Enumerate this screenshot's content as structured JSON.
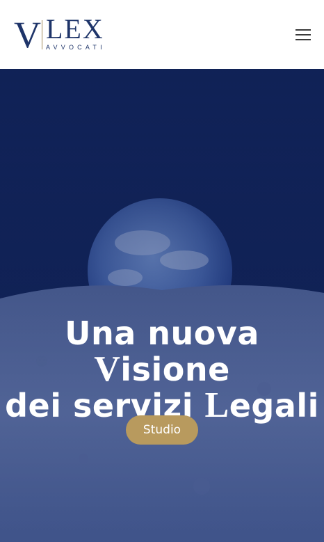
{
  "header": {
    "logo": {
      "mark": "V",
      "name": "LEX",
      "tagline": "AVVOCATI"
    },
    "menu_icon": "hamburger-menu-icon"
  },
  "hero": {
    "title_line1_a": "Una nuova ",
    "title_line1_b": "V",
    "title_line1_c": "isione",
    "title_line2_a": "dei servizi ",
    "title_line2_b": "L",
    "title_line2_c": "egali",
    "cta_label": "Studio",
    "image": "earthrise-over-moon"
  },
  "colors": {
    "brand_navy": "#1e3469",
    "accent_gold": "#b89a5e",
    "hero_overlay": "#0d1e52"
  }
}
